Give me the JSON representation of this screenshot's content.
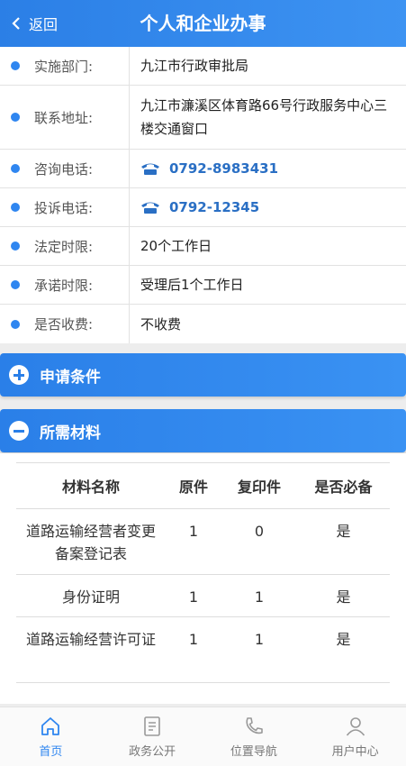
{
  "header": {
    "back_label": "返回",
    "title": "个人和企业办事"
  },
  "info": [
    {
      "label": "实施部门:",
      "value": "九江市行政审批局"
    },
    {
      "label": "联系地址:",
      "value": "九江市濂溪区体育路66号行政服务中心三楼交通窗口"
    },
    {
      "label": "咨询电话:",
      "value": "0792-8983431"
    },
    {
      "label": "投诉电话:",
      "value": "0792-12345"
    },
    {
      "label": "法定时限:",
      "value": "20个工作日"
    },
    {
      "label": "承诺时限:",
      "value": "受理后1个工作日"
    },
    {
      "label": "是否收费:",
      "value": "不收费"
    }
  ],
  "panels": {
    "conditions": "申请条件",
    "materials": "所需材料"
  },
  "materials": {
    "headers": [
      "材料名称",
      "原件",
      "复印件",
      "是否必备"
    ],
    "rows": [
      [
        "道路运输经营者变更备案登记表",
        "1",
        "0",
        "是"
      ],
      [
        "身份证明",
        "1",
        "1",
        "是"
      ],
      [
        "道路运输经营许可证",
        "1",
        "1",
        "是"
      ]
    ]
  },
  "tabs": [
    {
      "label": "首页",
      "icon": "home-icon",
      "active": true
    },
    {
      "label": "政务公开",
      "icon": "document-icon",
      "active": false
    },
    {
      "label": "位置导航",
      "icon": "phone-location-icon",
      "active": false
    },
    {
      "label": "用户中心",
      "icon": "user-icon",
      "active": false
    }
  ],
  "colors": {
    "primary": "#2f86f0",
    "phone_text": "#2a6fc4"
  }
}
